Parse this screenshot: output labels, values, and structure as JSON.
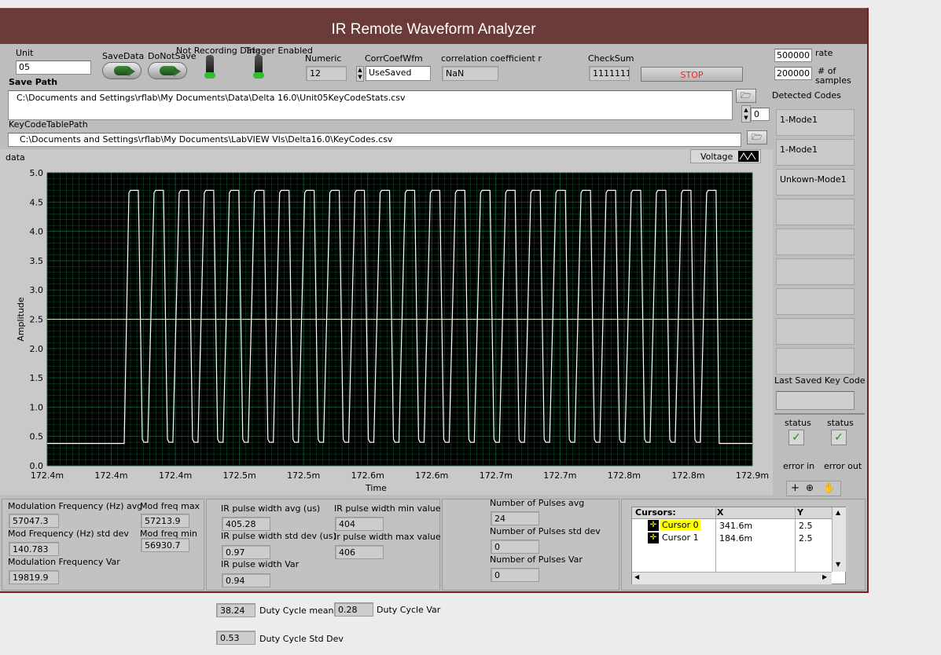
{
  "window": {
    "title": "IR Remote Waveform Analyzer"
  },
  "controls": {
    "unit_label": "Unit",
    "unit_value": "05",
    "savedata_label": "SaveData",
    "donotsave_label": "DoNotSave",
    "not_recording_label": "Not Recording Data",
    "trigger_label": "Trigger Enabled",
    "numeric_label": "Numeric",
    "numeric_value": "12",
    "corr_wfm_label": "CorrCoefWfm",
    "corr_wfm_value": "UseSaved",
    "corr_r_label": "correlation coefficient r",
    "corr_r_value": "NaN",
    "checksum_label": "CheckSum",
    "checksum_value": "1111111",
    "stop_label": "STOP",
    "rate_value": "500000",
    "rate_label": "rate",
    "samples_value": "200000",
    "samples_label_1": "# of",
    "samples_label_2": "samples",
    "save_path_label": "Save Path",
    "save_path_value": "C:\\Documents and Settings\\rflab\\My Documents\\Data\\Delta 16.0\\Unit05KeyCodeStats.csv",
    "keycode_path_label": "KeyCodeTablePath",
    "keycode_path_value": "C:\\Documents and Settings\\rflab\\My Documents\\LabVIEW VIs\\Delta16.0\\KeyCodes.csv",
    "detected_codes_label": "Detected Codes",
    "detected_index": "0",
    "detected_codes": [
      "1-Mode1",
      "1-Mode1",
      "Unkown-Mode1",
      "",
      "",
      "",
      "",
      "",
      ""
    ],
    "last_saved_label": "Last Saved Key Code",
    "last_saved_value": "",
    "error_in_status": "status",
    "error_in_label": "error in",
    "error_out_status": "status",
    "error_out_label": "error out"
  },
  "chart": {
    "label": "data",
    "legend": "Voltage"
  },
  "chart_data": {
    "type": "line",
    "xlabel": "Time",
    "ylabel": "Amplitude",
    "ylim": [
      0.0,
      5.0
    ],
    "yticks": [
      "0.0",
      "0.5",
      "1.0",
      "1.5",
      "2.0",
      "2.5",
      "3.0",
      "3.5",
      "4.0",
      "4.5",
      "5.0"
    ],
    "xticks": [
      "172.4m",
      "172.4m",
      "172.4m",
      "172.5m",
      "172.5m",
      "172.6m",
      "172.6m",
      "172.7m",
      "172.7m",
      "172.8m",
      "172.8m",
      "172.9m"
    ],
    "series": [
      {
        "name": "Voltage",
        "baseline": 0.38,
        "high": 4.7,
        "low": 0.4,
        "pulses": 24
      }
    ],
    "cursor_line_y": 2.5,
    "grid": true,
    "colors": {
      "background": "#000000",
      "grid": "#0e5a2e",
      "trace": "#ffffff"
    }
  },
  "stats": {
    "mod_freq_avg_label": "Modulation Frequency (Hz) avg",
    "mod_freq_avg": "57047.3",
    "mod_freq_std_label": "Mod Frequency (Hz) std dev",
    "mod_freq_std": "140.783",
    "mod_freq_var_label": "Modulation Frequency Var",
    "mod_freq_var": "19819.9",
    "mod_max_label": "Mod freq max",
    "mod_max": "57213.9",
    "mod_min_label": "Mod freq min",
    "mod_min": "56930.7",
    "pw_avg_label": "IR pulse width avg (us)",
    "pw_avg": "405.28",
    "pw_std_label": "IR pulse width std dev (us)",
    "pw_std": "0.97",
    "pw_var_label": "IR pulse width Var",
    "pw_var": "0.94",
    "pw_min_label": "IR pulse width min value",
    "pw_min": "404",
    "pw_max_label": "Ir pulse width max value",
    "pw_max": "406",
    "np_avg_label": "Number of Pulses avg",
    "np_avg": "24",
    "np_std_label": "Number of Pulses std dev",
    "np_std": "0",
    "np_var_label": "Number of Pulses Var",
    "np_var": "0",
    "duty_mean": "38.24",
    "duty_mean_label": "Duty Cycle mean",
    "duty_var": "0.28",
    "duty_var_label": "Duty Cycle Var",
    "duty_std": "0.53",
    "duty_std_label": "Duty Cycle Std Dev"
  },
  "cursors": {
    "headers": [
      "Cursors:",
      "X",
      "Y"
    ],
    "rows": [
      {
        "name": "Cursor 0",
        "x": "341.6m",
        "y": "2.5"
      },
      {
        "name": "Cursor 1",
        "x": "184.6m",
        "y": "2.5"
      }
    ]
  }
}
